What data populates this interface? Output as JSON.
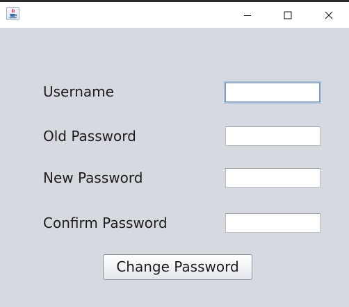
{
  "window": {
    "app_icon": "java-cup-icon",
    "controls": {
      "minimize": "minimize-icon",
      "maximize": "maximize-icon",
      "close": "close-icon"
    }
  },
  "form": {
    "username_label": "Username",
    "username_value": "",
    "old_password_label": "Old Password",
    "old_password_value": "",
    "new_password_label": "New Password",
    "new_password_value": "",
    "confirm_password_label": "Confirm Password",
    "confirm_password_value": "",
    "submit_label": "Change Password"
  },
  "colors": {
    "content_background": "#d6d9df",
    "focus_border": "#a3bcd6"
  }
}
